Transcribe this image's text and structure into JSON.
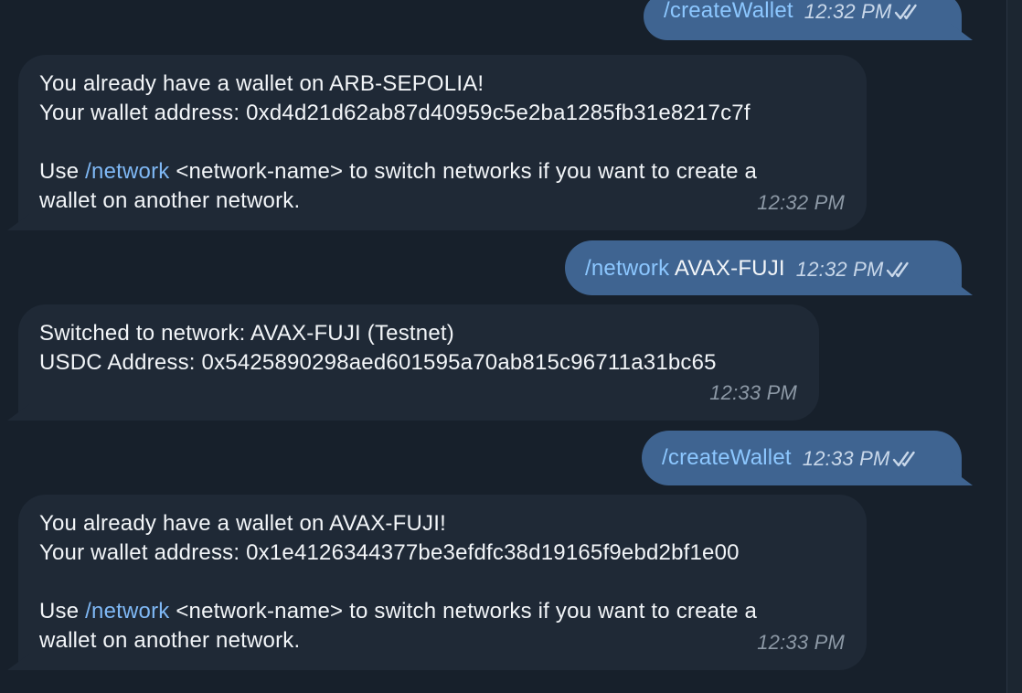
{
  "messages": [
    {
      "id": "m1",
      "direction": "out",
      "parts": [
        {
          "text": "/createWallet",
          "command": true
        }
      ],
      "time": "12:32 PM",
      "read_icon": "double-check-icon"
    },
    {
      "id": "m2",
      "direction": "in",
      "lines": [
        "You already have a wallet on ARB-SEPOLIA!",
        "Your wallet address: 0xd4d21d62ab87d40959c5e2ba1285fb31e8217c7f",
        "",
        {
          "command": "/network",
          "rest": " <network-name> to switch networks if you want to create a",
          "prefix": "Use "
        },
        "wallet on another network."
      ],
      "time": "12:32 PM"
    },
    {
      "id": "m3",
      "direction": "out",
      "parts": [
        {
          "text": "/network",
          "command": true
        },
        {
          "text": " AVAX-FUJI",
          "command": false
        }
      ],
      "time": "12:32 PM",
      "read_icon": "double-check-icon"
    },
    {
      "id": "m4",
      "direction": "in",
      "lines": [
        "Switched to network: AVAX-FUJI (Testnet)",
        "USDC Address: 0x5425890298aed601595a70ab815c96711a31bc65"
      ],
      "time": "12:33 PM"
    },
    {
      "id": "m5",
      "direction": "out",
      "parts": [
        {
          "text": "/createWallet",
          "command": true
        }
      ],
      "time": "12:33 PM",
      "read_icon": "double-check-icon"
    },
    {
      "id": "m6",
      "direction": "in",
      "lines": [
        "You already have a wallet on AVAX-FUJI!",
        "Your wallet address: 0x1e4126344377be3efdfc38d19165f9ebd2bf1e00",
        "",
        {
          "command": "/network",
          "rest": " <network-name> to switch networks if you want to create a",
          "prefix": "Use "
        },
        "wallet on another network."
      ],
      "time": "12:33 PM"
    }
  ],
  "colors": {
    "background": "#17202b",
    "incoming_bubble": "#1f2936",
    "outgoing_bubble": "#3f6491",
    "command_link": "#7fb8f5"
  }
}
